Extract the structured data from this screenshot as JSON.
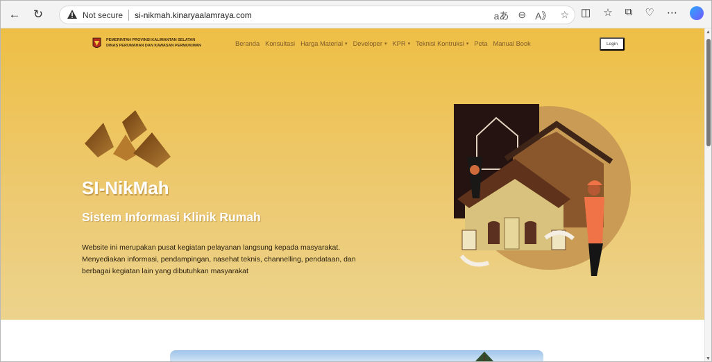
{
  "browser": {
    "not_secure": "Not secure",
    "url": "si-nikmah.kinaryaalamraya.com",
    "icons": [
      "back-icon",
      "refresh-icon",
      "warning-icon",
      "translate-icon",
      "zoom-icon",
      "read-aloud-icon",
      "favorite-icon",
      "split-screen-icon",
      "favorites-icon",
      "collections-icon",
      "browser-essentials-icon",
      "more-icon",
      "copilot-icon"
    ]
  },
  "navbar": {
    "agency_line1": "PEMERINTAH PROVINSI KALIMANTAN SELATAN",
    "agency_line2": "DINAS PERUMAHAN DAN KAWASAN PERMUKIMAN",
    "menu": [
      "Beranda",
      "Konsultasi",
      "Harga Material",
      "Developer",
      "KPR",
      "Teknisi Kontruksi",
      "Peta",
      "Manual Book"
    ],
    "login": "Login"
  },
  "hero": {
    "title": "SI-NikMah",
    "subtitle": "Sistem Informasi Klinik Rumah",
    "description": "Website ini merupakan pusat kegiatan pelayanan langsung kepada masyarakat. Menyediakan informasi, pendampingan, nasehat teknis, channelling, pendataan, dan berbagai kegiatan lain yang dibutuhkan masyarakat"
  },
  "colors": {
    "hero_top": "#eebf45",
    "hero_bottom": "#ecd38c",
    "menu_text": "#7e5a2b",
    "title": "#ffffff"
  }
}
